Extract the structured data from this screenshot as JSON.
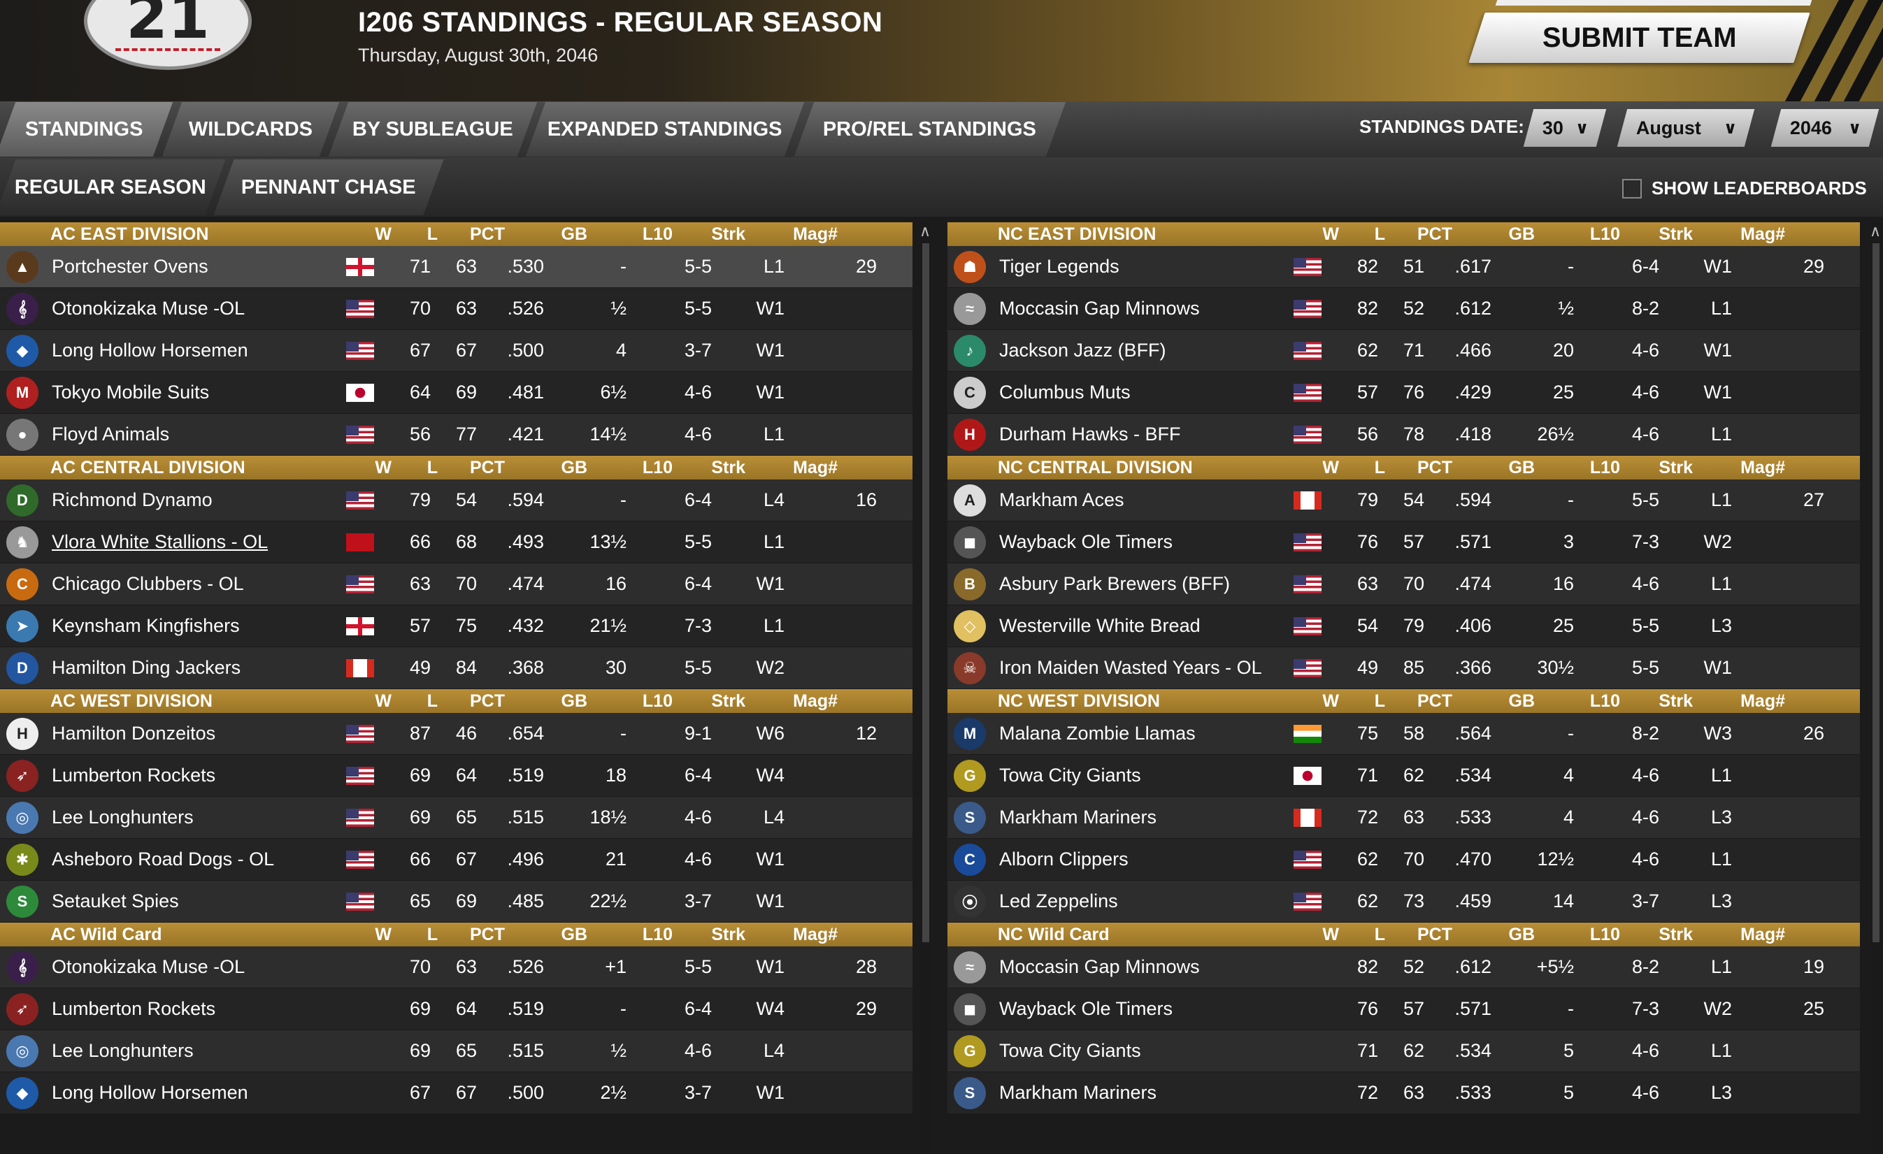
{
  "header": {
    "logo_text": "21",
    "title": "I206 STANDINGS - REGULAR SEASON",
    "date": "Thursday, August 30th, 2046",
    "submit_label": "SUBMIT TEAM"
  },
  "main_tabs": [
    "STANDINGS",
    "WILDCARDS",
    "BY SUBLEAGUE",
    "EXPANDED STANDINGS",
    "PRO/REL STANDINGS"
  ],
  "standings_date": {
    "label": "STANDINGS DATE:",
    "day": "30",
    "month": "August",
    "year": "2046"
  },
  "sub_tabs": [
    "REGULAR SEASON",
    "PENNANT CHASE"
  ],
  "show_leaderboards_label": "SHOW LEADERBOARDS",
  "columns": {
    "w": "W",
    "l": "L",
    "pct": "PCT",
    "gb": "GB",
    "l10": "L10",
    "strk": "Strk",
    "mag": "Mag#"
  },
  "colors": {
    "accent": "#b98e36",
    "header_dark": "#1e1c1a"
  },
  "left_divisions": [
    {
      "name": "AC EAST DIVISION",
      "teams": [
        {
          "name": "Portchester Ovens",
          "flag": "england",
          "icon": "oven-logo-icon",
          "w": "71",
          "l": "63",
          "pct": ".530",
          "gb": "-",
          "l10": "5-5",
          "strk": "L1",
          "mag": "29"
        },
        {
          "name": "Otonokizaka Muse -OL",
          "flag": "usa",
          "icon": "muse-logo-icon",
          "w": "70",
          "l": "63",
          "pct": ".526",
          "gb": "½",
          "l10": "5-5",
          "strk": "W1",
          "mag": ""
        },
        {
          "name": "Long Hollow Horsemen",
          "flag": "usa",
          "icon": "horsemen-logo-icon",
          "w": "67",
          "l": "67",
          "pct": ".500",
          "gb": "4",
          "l10": "3-7",
          "strk": "W1",
          "mag": ""
        },
        {
          "name": "Tokyo Mobile Suits",
          "flag": "japan",
          "icon": "ms-logo-icon",
          "w": "64",
          "l": "69",
          "pct": ".481",
          "gb": "6½",
          "l10": "4-6",
          "strk": "W1",
          "mag": ""
        },
        {
          "name": "Floyd Animals",
          "flag": "usa",
          "icon": "animals-logo-icon",
          "w": "56",
          "l": "77",
          "pct": ".421",
          "gb": "14½",
          "l10": "4-6",
          "strk": "L1",
          "mag": ""
        }
      ]
    },
    {
      "name": "AC CENTRAL DIVISION",
      "teams": [
        {
          "name": "Richmond Dynamo",
          "flag": "usa",
          "icon": "dynamo-logo-icon",
          "w": "79",
          "l": "54",
          "pct": ".594",
          "gb": "-",
          "l10": "6-4",
          "strk": "L4",
          "mag": "16"
        },
        {
          "name": "Vlora White Stallions - OL",
          "flag": "albania",
          "icon": "stallion-logo-icon",
          "w": "66",
          "l": "68",
          "pct": ".493",
          "gb": "13½",
          "l10": "5-5",
          "strk": "L1",
          "mag": ""
        },
        {
          "name": "Chicago Clubbers - OL",
          "flag": "usa",
          "icon": "clubbers-logo-icon",
          "w": "63",
          "l": "70",
          "pct": ".474",
          "gb": "16",
          "l10": "6-4",
          "strk": "W1",
          "mag": ""
        },
        {
          "name": "Keynsham Kingfishers",
          "flag": "england",
          "icon": "kingfisher-logo-icon",
          "w": "57",
          "l": "75",
          "pct": ".432",
          "gb": "21½",
          "l10": "7-3",
          "strk": "L1",
          "mag": ""
        },
        {
          "name": "Hamilton Ding Jackers",
          "flag": "canada",
          "icon": "dingjackers-logo-icon",
          "w": "49",
          "l": "84",
          "pct": ".368",
          "gb": "30",
          "l10": "5-5",
          "strk": "W2",
          "mag": ""
        }
      ]
    },
    {
      "name": "AC WEST DIVISION",
      "teams": [
        {
          "name": "Hamilton Donzeitos",
          "flag": "usa",
          "icon": "donzeitos-logo-icon",
          "w": "87",
          "l": "46",
          "pct": ".654",
          "gb": "-",
          "l10": "9-1",
          "strk": "W6",
          "mag": "12"
        },
        {
          "name": "Lumberton Rockets",
          "flag": "usa",
          "icon": "rocket-logo-icon",
          "w": "69",
          "l": "64",
          "pct": ".519",
          "gb": "18",
          "l10": "6-4",
          "strk": "W4",
          "mag": ""
        },
        {
          "name": "Lee Longhunters",
          "flag": "usa",
          "icon": "longhunters-logo-icon",
          "w": "69",
          "l": "65",
          "pct": ".515",
          "gb": "18½",
          "l10": "4-6",
          "strk": "L4",
          "mag": ""
        },
        {
          "name": "Asheboro Road Dogs - OL",
          "flag": "usa",
          "icon": "roaddogs-logo-icon",
          "w": "66",
          "l": "67",
          "pct": ".496",
          "gb": "21",
          "l10": "4-6",
          "strk": "W1",
          "mag": ""
        },
        {
          "name": "Setauket Spies",
          "flag": "usa",
          "icon": "spies-logo-icon",
          "w": "65",
          "l": "69",
          "pct": ".485",
          "gb": "22½",
          "l10": "3-7",
          "strk": "W1",
          "mag": ""
        }
      ]
    },
    {
      "name": "AC  Wild Card",
      "teams": [
        {
          "name": "Otonokizaka Muse -OL",
          "flag": "",
          "icon": "muse-logo-icon",
          "w": "70",
          "l": "63",
          "pct": ".526",
          "gb": "+1",
          "l10": "5-5",
          "strk": "W1",
          "mag": "28"
        },
        {
          "name": "Lumberton Rockets",
          "flag": "",
          "icon": "rocket-logo-icon",
          "w": "69",
          "l": "64",
          "pct": ".519",
          "gb": "-",
          "l10": "6-4",
          "strk": "W4",
          "mag": "29"
        },
        {
          "name": "Lee Longhunters",
          "flag": "",
          "icon": "longhunters-logo-icon",
          "w": "69",
          "l": "65",
          "pct": ".515",
          "gb": "½",
          "l10": "4-6",
          "strk": "L4",
          "mag": ""
        },
        {
          "name": "Long Hollow Horsemen",
          "flag": "",
          "icon": "horsemen-logo-icon",
          "w": "67",
          "l": "67",
          "pct": ".500",
          "gb": "2½",
          "l10": "3-7",
          "strk": "W1",
          "mag": ""
        }
      ]
    }
  ],
  "right_divisions": [
    {
      "name": "NC EAST DIVISION",
      "teams": [
        {
          "name": "Tiger Legends",
          "flag": "usa",
          "icon": "tiger-logo-icon",
          "w": "82",
          "l": "51",
          "pct": ".617",
          "gb": "-",
          "l10": "6-4",
          "strk": "W1",
          "mag": "29"
        },
        {
          "name": "Moccasin Gap Minnows",
          "flag": "usa",
          "icon": "minnows-logo-icon",
          "w": "82",
          "l": "52",
          "pct": ".612",
          "gb": "½",
          "l10": "8-2",
          "strk": "L1",
          "mag": ""
        },
        {
          "name": "Jackson Jazz (BFF)",
          "flag": "usa",
          "icon": "jazz-logo-icon",
          "w": "62",
          "l": "71",
          "pct": ".466",
          "gb": "20",
          "l10": "4-6",
          "strk": "W1",
          "mag": ""
        },
        {
          "name": "Columbus Muts",
          "flag": "usa",
          "icon": "muts-logo-icon",
          "w": "57",
          "l": "76",
          "pct": ".429",
          "gb": "25",
          "l10": "4-6",
          "strk": "W1",
          "mag": ""
        },
        {
          "name": "Durham Hawks - BFF",
          "flag": "usa",
          "icon": "hawks-logo-icon",
          "w": "56",
          "l": "78",
          "pct": ".418",
          "gb": "26½",
          "l10": "4-6",
          "strk": "L1",
          "mag": ""
        }
      ]
    },
    {
      "name": "NC CENTRAL DIVISION",
      "teams": [
        {
          "name": "Markham Aces",
          "flag": "canada",
          "icon": "aces-logo-icon",
          "w": "79",
          "l": "54",
          "pct": ".594",
          "gb": "-",
          "l10": "5-5",
          "strk": "L1",
          "mag": "27"
        },
        {
          "name": "Wayback Ole Timers",
          "flag": "usa",
          "icon": "oletimers-logo-icon",
          "w": "76",
          "l": "57",
          "pct": ".571",
          "gb": "3",
          "l10": "7-3",
          "strk": "W2",
          "mag": ""
        },
        {
          "name": "Asbury Park Brewers (BFF)",
          "flag": "usa",
          "icon": "brewers-logo-icon",
          "w": "63",
          "l": "70",
          "pct": ".474",
          "gb": "16",
          "l10": "4-6",
          "strk": "L1",
          "mag": ""
        },
        {
          "name": "Westerville White Bread",
          "flag": "usa",
          "icon": "whitebread-logo-icon",
          "w": "54",
          "l": "79",
          "pct": ".406",
          "gb": "25",
          "l10": "5-5",
          "strk": "L3",
          "mag": ""
        },
        {
          "name": "Iron Maiden Wasted Years - OL",
          "flag": "usa",
          "icon": "ironmaiden-logo-icon",
          "w": "49",
          "l": "85",
          "pct": ".366",
          "gb": "30½",
          "l10": "5-5",
          "strk": "W1",
          "mag": ""
        }
      ]
    },
    {
      "name": "NC WEST DIVISION",
      "teams": [
        {
          "name": "Malana Zombie Llamas",
          "flag": "india",
          "icon": "llamas-logo-icon",
          "w": "75",
          "l": "58",
          "pct": ".564",
          "gb": "-",
          "l10": "8-2",
          "strk": "W3",
          "mag": "26"
        },
        {
          "name": "Towa City Giants",
          "flag": "japan",
          "icon": "giants-logo-icon",
          "w": "71",
          "l": "62",
          "pct": ".534",
          "gb": "4",
          "l10": "4-6",
          "strk": "L1",
          "mag": ""
        },
        {
          "name": "Markham Mariners",
          "flag": "canada",
          "icon": "mariners-logo-icon",
          "w": "72",
          "l": "63",
          "pct": ".533",
          "gb": "4",
          "l10": "4-6",
          "strk": "L3",
          "mag": ""
        },
        {
          "name": "Alborn Clippers",
          "flag": "usa",
          "icon": "clippers-logo-icon",
          "w": "62",
          "l": "70",
          "pct": ".470",
          "gb": "12½",
          "l10": "4-6",
          "strk": "L1",
          "mag": ""
        },
        {
          "name": "Led Zeppelins",
          "flag": "usa",
          "icon": "zeppelins-logo-icon",
          "w": "62",
          "l": "73",
          "pct": ".459",
          "gb": "14",
          "l10": "3-7",
          "strk": "L3",
          "mag": ""
        }
      ]
    },
    {
      "name": "NC  Wild Card",
      "teams": [
        {
          "name": "Moccasin Gap Minnows",
          "flag": "",
          "icon": "minnows-logo-icon",
          "w": "82",
          "l": "52",
          "pct": ".612",
          "gb": "+5½",
          "l10": "8-2",
          "strk": "L1",
          "mag": "19"
        },
        {
          "name": "Wayback Ole Timers",
          "flag": "",
          "icon": "oletimers-logo-icon",
          "w": "76",
          "l": "57",
          "pct": ".571",
          "gb": "-",
          "l10": "7-3",
          "strk": "W2",
          "mag": "25"
        },
        {
          "name": "Towa City Giants",
          "flag": "",
          "icon": "giants-logo-icon",
          "w": "71",
          "l": "62",
          "pct": ".534",
          "gb": "5",
          "l10": "4-6",
          "strk": "L1",
          "mag": ""
        },
        {
          "name": "Markham Mariners",
          "flag": "",
          "icon": "mariners-logo-icon",
          "w": "72",
          "l": "63",
          "pct": ".533",
          "gb": "5",
          "l10": "4-6",
          "strk": "L3",
          "mag": ""
        }
      ]
    }
  ]
}
